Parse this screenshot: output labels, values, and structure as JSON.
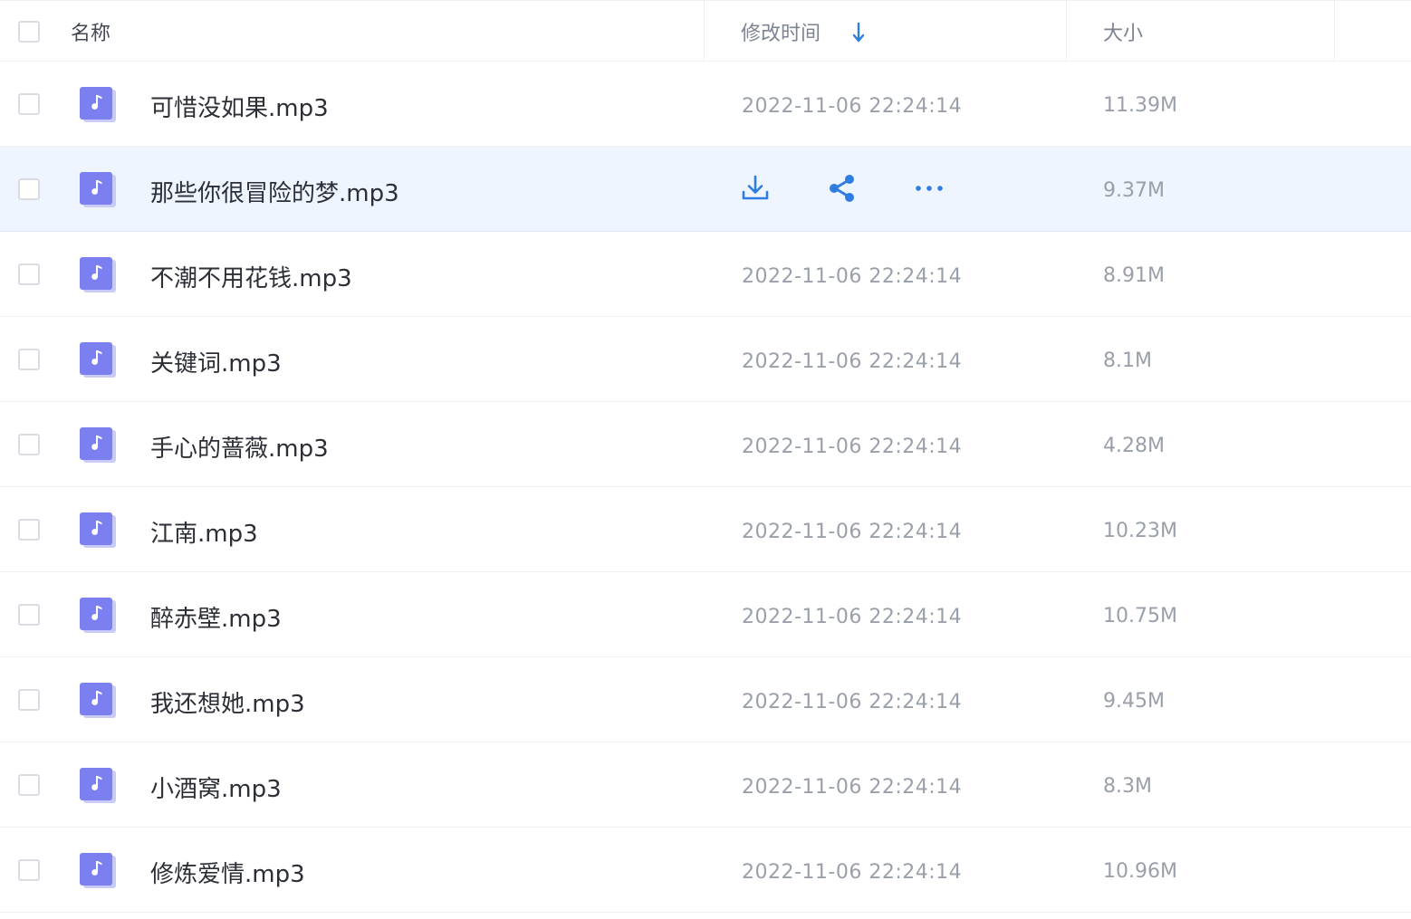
{
  "header": {
    "name_label": "名称",
    "modified_label": "修改时间",
    "size_label": "大小",
    "sort_icon": "arrow-down-icon"
  },
  "colors": {
    "accent": "#2f7de1",
    "file_icon": "#7b7ff0",
    "selected_row_bg": "#eef5ff",
    "muted_text": "#9aa0aa"
  },
  "files": [
    {
      "name": "可惜没如果.mp3",
      "modified": "2022-11-06 22:24:14",
      "size": "11.39M",
      "icon": "music-file-icon"
    },
    {
      "name": "那些你很冒险的梦.mp3",
      "modified": "2022-11-06 22:24:14",
      "size": "9.37M",
      "icon": "music-file-icon",
      "selected": true
    },
    {
      "name": "不潮不用花钱.mp3",
      "modified": "2022-11-06 22:24:14",
      "size": "8.91M",
      "icon": "music-file-icon"
    },
    {
      "name": "关键词.mp3",
      "modified": "2022-11-06 22:24:14",
      "size": "8.1M",
      "icon": "music-file-icon"
    },
    {
      "name": "手心的蔷薇.mp3",
      "modified": "2022-11-06 22:24:14",
      "size": "4.28M",
      "icon": "music-file-icon"
    },
    {
      "name": "江南.mp3",
      "modified": "2022-11-06 22:24:14",
      "size": "10.23M",
      "icon": "music-file-icon"
    },
    {
      "name": "醉赤壁.mp3",
      "modified": "2022-11-06 22:24:14",
      "size": "10.75M",
      "icon": "music-file-icon"
    },
    {
      "name": "我还想她.mp3",
      "modified": "2022-11-06 22:24:14",
      "size": "9.45M",
      "icon": "music-file-icon"
    },
    {
      "name": "小酒窝.mp3",
      "modified": "2022-11-06 22:24:14",
      "size": "8.3M",
      "icon": "music-file-icon"
    },
    {
      "name": "修炼爱情.mp3",
      "modified": "2022-11-06 22:24:14",
      "size": "10.96M",
      "icon": "music-file-icon"
    }
  ],
  "row_actions": [
    "download-icon",
    "share-icon",
    "more-icon"
  ]
}
